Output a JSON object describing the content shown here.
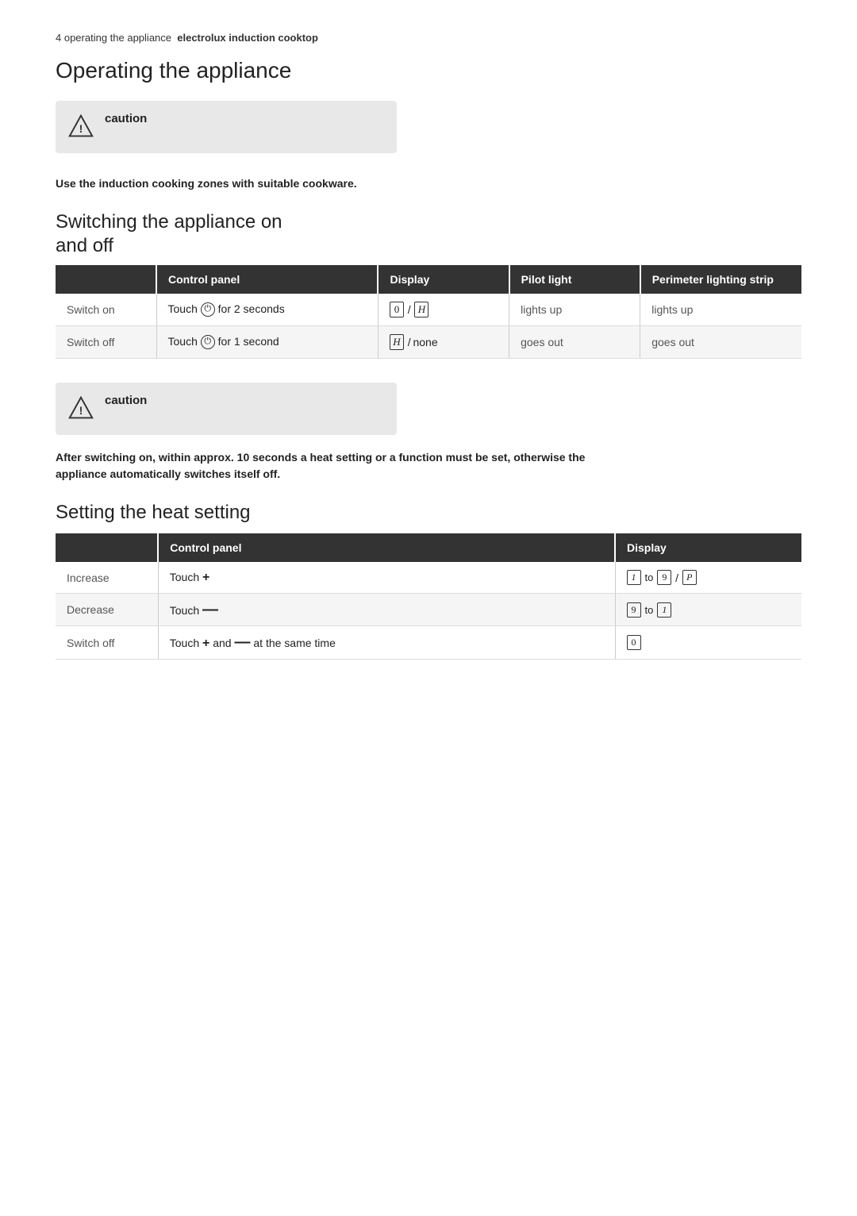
{
  "page": {
    "number_line": "4  operating the appliance",
    "number_line_bold": "electrolux induction cooktop"
  },
  "section1": {
    "title": "Operating the appliance"
  },
  "caution1": {
    "label": "caution",
    "text": "Use the induction cooking zones with suitable cookware."
  },
  "section2": {
    "title": "Switching the appliance on",
    "subtitle": "and off"
  },
  "table1": {
    "headers": [
      "",
      "Control panel",
      "Display",
      "Pilot light",
      "Perimeter lighting strip"
    ],
    "rows": [
      {
        "col0": "Switch on",
        "col1": "Touch",
        "col1_symbol": "circle-i",
        "col1_extra": "for 2 seconds",
        "col2_type": "box-slash-box",
        "col2_left": "0",
        "col2_right": "H",
        "col3": "lights up",
        "col4": "lights up"
      },
      {
        "col0": "Switch off",
        "col1": "Touch",
        "col1_symbol": "circle-i",
        "col1_extra": "for 1 second",
        "col2_type": "box-slash-none",
        "col2_left": "H",
        "col2_right": "none",
        "col3": "goes out",
        "col4": "goes out"
      }
    ]
  },
  "caution2": {
    "label": "caution",
    "text": "After switching on, within approx. 10 seconds a heat setting or a function must be set, otherwise the appliance automatically switches itself off."
  },
  "section3": {
    "title": "Setting the heat setting"
  },
  "table2": {
    "headers": [
      "",
      "Control panel",
      "Display"
    ],
    "rows": [
      {
        "col0": "Increase",
        "col1": "Touch +",
        "col2_type": "1-to-9-P",
        "col2_text": "1 to 9 / P"
      },
      {
        "col0": "Decrease",
        "col1": "Touch —",
        "col2_type": "9-to-1",
        "col2_text": "9 to 1"
      },
      {
        "col0": "Switch off",
        "col1": "Touch + and — at the same time",
        "col2_type": "0-box",
        "col2_text": "0"
      }
    ]
  }
}
